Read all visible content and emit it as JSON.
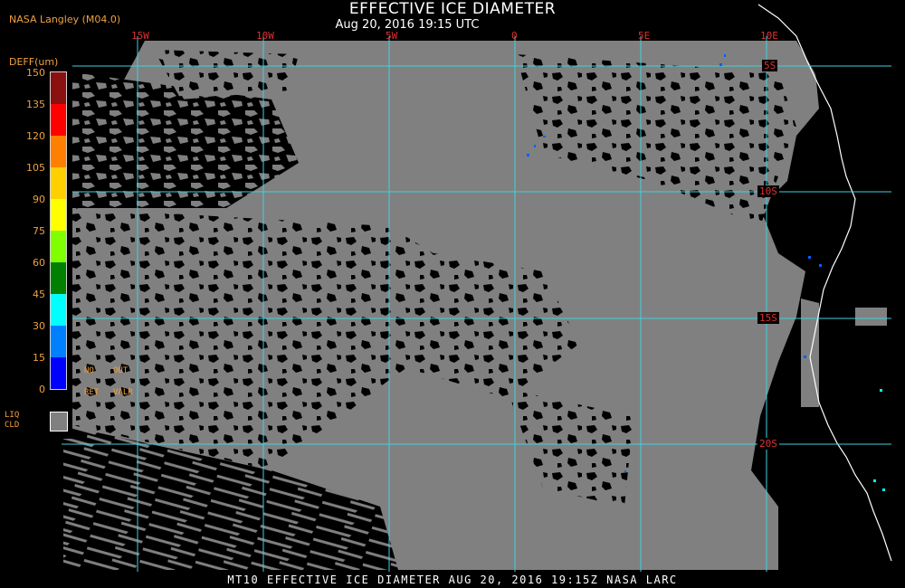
{
  "header": {
    "title": "EFFECTIVE ICE DIAMETER",
    "subtitle": "Aug 20, 2016 19:15 UTC",
    "source": "NASA Langley (M04.0)"
  },
  "map": {
    "lon_labels": [
      "15W",
      "10W",
      "5W",
      "0",
      "5E",
      "10E"
    ],
    "lat_labels": [
      "5S",
      "10S",
      "15S",
      "20S"
    ],
    "colors": {
      "background": "#000000",
      "cloud": "#808080",
      "grid": "#40d0e0",
      "coast": "#ffffff",
      "grid_label": "#e03030"
    }
  },
  "colorbar": {
    "title": "DEFF(um)",
    "ticks": [
      "150",
      "135",
      "120",
      "105",
      "90",
      "75",
      "60",
      "45",
      "30",
      "15",
      "0"
    ],
    "colors": [
      "#8b1010",
      "#ff0000",
      "#ff8000",
      "#ffd000",
      "#ffff00",
      "#80ff00",
      "#008000",
      "#00ffff",
      "#0080ff",
      "#0000ff",
      "#8040ff"
    ],
    "no_ret": [
      "NO",
      "RET"
    ],
    "out_valr": [
      "OUT",
      "VALR"
    ],
    "liq_label": [
      "LIQ",
      "CLD"
    ]
  },
  "footer": "MT10  EFFECTIVE ICE DIAMETER  AUG 20, 2016 19:15Z  NASA LARC"
}
